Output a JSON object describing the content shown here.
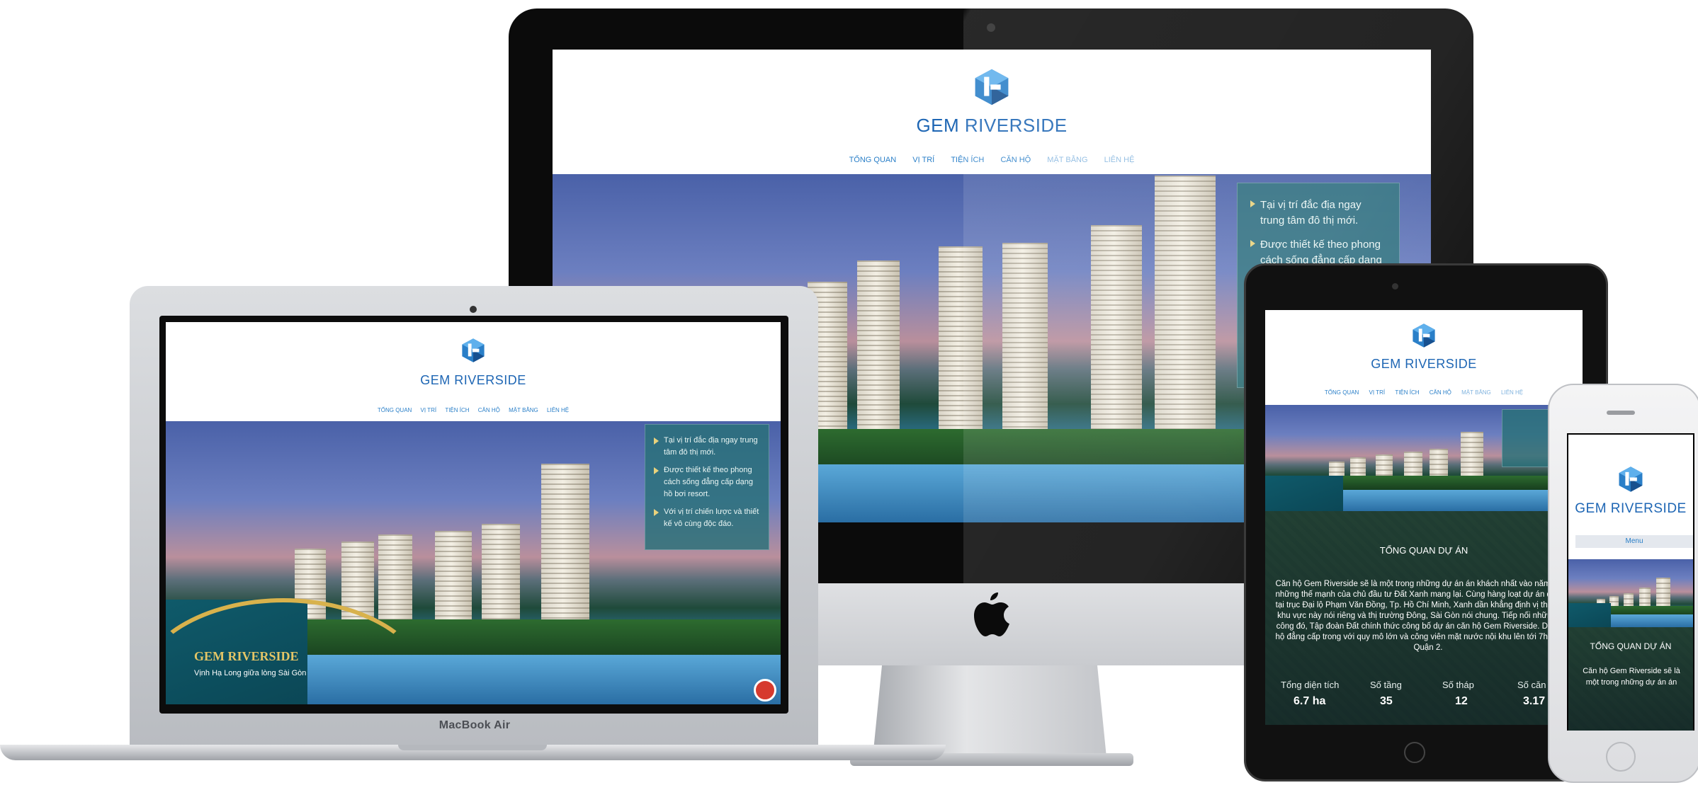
{
  "site": {
    "brand_name": "GEM RIVERSIDE",
    "nav": [
      "TỔNG QUAN",
      "VỊ TRÍ",
      "TIỆN ÍCH",
      "CĂN HỘ",
      "MẶT BẰNG",
      "LIÊN HỆ"
    ],
    "hero_bullets": [
      "Tại vị trí đắc địa ngay trung tâm đô thị mới.",
      "Được thiết kế theo phong cách sống đẳng cấp dạng hồ bơi resort.",
      "Với vị trí chiến lược và thiết kế vô cùng độc đáo."
    ],
    "promo_title": "GEM RIVERSIDE",
    "promo_sub": "Vịnh Hạ Long giữa lòng Sài Gòn",
    "overview_title": "TỔNG QUAN DỰ ÁN",
    "overview_text": "Căn hộ Gem Riverside sẽ là một trong những dự án án khách nhất vào năm 2017 từ những thế mạnh của chủ đầu tư Đất Xanh mang lại. Cùng hàng loạt dự án đình đám tại trục Đại lộ Phạm Văn Đồng, Tp. Hồ Chí Minh, Xanh dần khẳng định vị thế số 1 tại khu vực này nói riêng và thị trường Đông, Sài Gòn nói chung. Tiếp nối những thành công đó, Tập đoàn Đất chính thức công bố dự án căn hộ Gem Riverside. Dự án căn hộ đẳng cấp trong với quy mô lớn và công viên mặt nước nội khu lên tới 7ha quy nhi Quận 2.",
    "stats": [
      {
        "label": "Tổng diện tích",
        "value": "6.7 ha"
      },
      {
        "label": "Số tầng",
        "value": "35"
      },
      {
        "label": "Số tháp",
        "value": "12"
      },
      {
        "label": "Số căn",
        "value": "3.17"
      }
    ],
    "phone_menu": "Menu",
    "phone_overview_text": "Căn hộ Gem Riverside sẽ là một trong những dự án án"
  },
  "devices": {
    "laptop_label": "MacBook Air"
  },
  "colors": {
    "brand_blue": "#1e66b4",
    "nav_blue": "#2a7fc8",
    "gold": "#d8b24c",
    "teal_box": "#287078"
  }
}
